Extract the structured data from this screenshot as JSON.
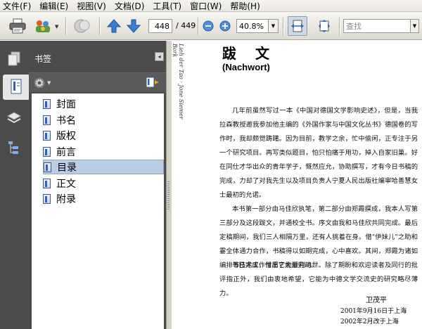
{
  "menu": [
    "文件(F)",
    "编辑(E)",
    "视图(V)",
    "文档(D)",
    "工具(T)",
    "窗口(W)",
    "帮助(H)"
  ],
  "toolbar": {
    "current_page": "448",
    "page_total": "/ 449",
    "zoom": "40.8%",
    "search_placeholder": "查找",
    "icons": [
      "print-icon",
      "share-icon",
      "hand-tool-icon",
      "previous-page-icon",
      "next-page-icon",
      "zoom-out-icon",
      "zoom-in-icon",
      "fit-width-icon",
      "fit-page-icon"
    ]
  },
  "sidebar": {
    "icons": [
      "pages-icon",
      "bookmarks-icon",
      "layers-icon",
      "model-tree-icon"
    ]
  },
  "panel": {
    "title": "书签",
    "close_label": "◂",
    "bookmarks": [
      {
        "label": "封面",
        "selected": false
      },
      {
        "label": "书名",
        "selected": false
      },
      {
        "label": "版权",
        "selected": false
      },
      {
        "label": "前言",
        "selected": false
      },
      {
        "label": "目录",
        "selected": true
      },
      {
        "label": "正文",
        "selected": false
      },
      {
        "label": "附录",
        "selected": false
      }
    ]
  },
  "document": {
    "side_note": "Lieh der Tao · Jone Siemer Bork",
    "title": "跋 文",
    "subtitle": "(Nachwort)",
    "paragraphs": [
      "几年前虽然写过一本《中国对德国文学影响史述》，但是，当我拉森教授邀我参加他主编的《外国作家与中国文化丛书》德国卷的写作时，我却颇觉踌躇。因为目前，教学之余，忙中偷闲，正专注于另一个研究项目。再写类似题目，怕只怕痛于用功，掉入自家旧巢。好在同仕才华出众的青年学子，慨然应允，协助撰写，才有今日书稿的完成，力却了对我先生以及项目负责人宁夏人民出版社编审哈善慧女士最初的允诺。",
      "本书第一部分由马佳欣执笔，第二部分由郑霞撰成，我本人写第三部分及这段跋文，并通校全书。序文由我和马佳欣共同完成。最后定稿期间，我们三人相隔万里，还有人挑着在身。借\"伊妹儿\"之助和霎全体通力合作，书稿得以如期完成，心中喜欢。其间，郑霞为诸如编排等技术工作付出了大量劳动。",
      "书已完成，惟愿它能顺利问世。除了期盼和欢迎读者及同行的批评指正外，我们由衷地希望，它能为中德文学交流史的研究略尽薄力。"
    ],
    "signature": "卫茂平",
    "date_line1": "2001年9月16日于上海",
    "date_line2": "2002年2月改于上海"
  },
  "colors": {
    "panel_bg": "#4b4b4b",
    "selected_bg": "#b9cde4",
    "toolbar_bg": "#e6e4dc",
    "accent_blue": "#2f63b5"
  }
}
